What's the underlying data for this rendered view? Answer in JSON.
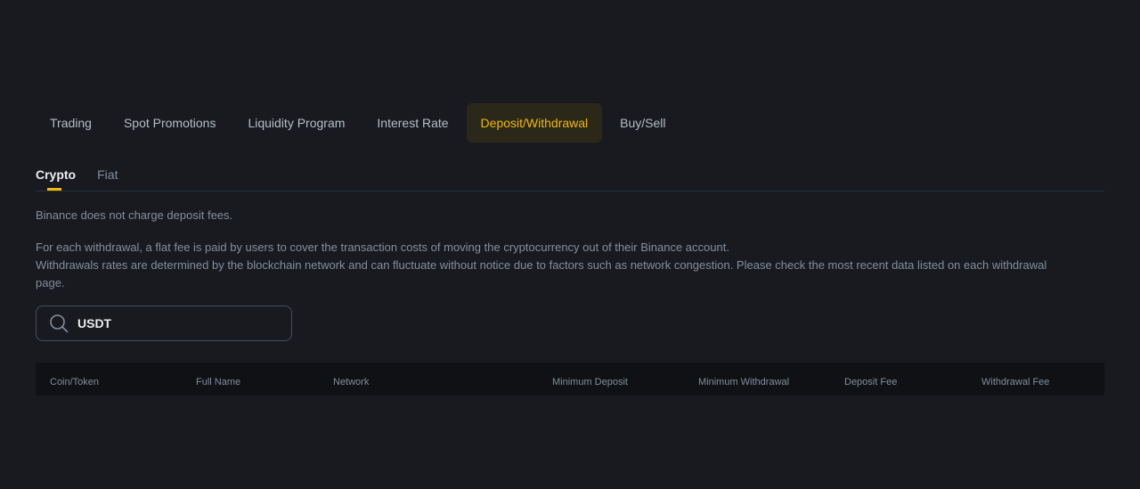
{
  "top_tabs": [
    {
      "label": "Trading"
    },
    {
      "label": "Spot Promotions"
    },
    {
      "label": "Liquidity Program"
    },
    {
      "label": "Interest Rate"
    },
    {
      "label": "Deposit/Withdrawal",
      "active": true
    },
    {
      "label": "Buy/Sell"
    }
  ],
  "sub_tabs": [
    {
      "label": "Crypto",
      "active": true
    },
    {
      "label": "Fiat"
    }
  ],
  "notes": {
    "deposit": "Binance does not charge deposit fees.",
    "withdrawal_line1": "For each withdrawal, a flat fee is paid by users to cover the transaction costs of moving the cryptocurrency out of their Binance account.",
    "withdrawal_line2": "Withdrawals rates are determined by the blockchain network and can fluctuate without notice due to factors such as network congestion. Please check the most recent data listed on each withdrawal page."
  },
  "search": {
    "value": "USDT",
    "icon": "search-icon"
  },
  "table": {
    "columns": [
      "Coin/Token",
      "Full Name",
      "Network",
      "Minimum Deposit",
      "Minimum Withdrawal",
      "Deposit Fee",
      "Withdrawal Fee"
    ]
  },
  "colors": {
    "background": "#181a20",
    "accent": "#f0b90b",
    "active_tab_bg": "#2b2719",
    "text_muted": "#848e9c",
    "text_primary": "#eaecef"
  }
}
